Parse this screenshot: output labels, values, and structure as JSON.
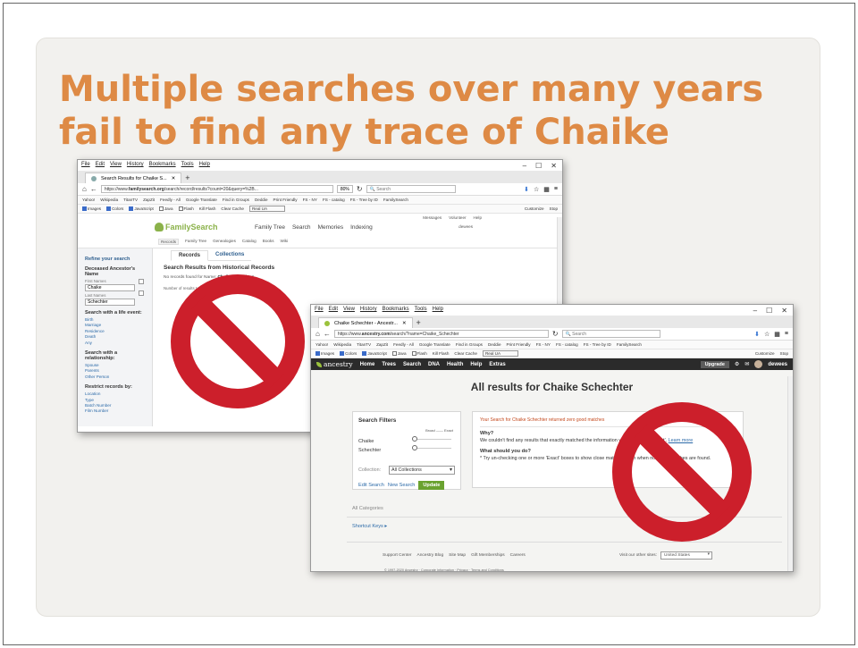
{
  "slide": {
    "title_line1": "Multiple searches over many years",
    "title_line2": "fail to find any trace of Chaike",
    "accent_color": "#de8a45",
    "prohibition_color": "#cc1f2b"
  },
  "familysearch": {
    "menu": [
      "File",
      "Edit",
      "View",
      "History",
      "Bookmarks",
      "Tools",
      "Help"
    ],
    "tab_title": "Search Results for Chaike S...",
    "url_host": "familysearch.org",
    "url_prefix": "https://www.",
    "url_path": "/search/record/results?count=20&query=%2B...",
    "zoom": "80%",
    "search_placeholder": "Search",
    "bookmarks": [
      "Yahoo!",
      "Wikipedia",
      "TitanTV",
      "ZapZit",
      "Feedly - All",
      "Google Translate",
      "Find in Groups",
      "Deddie",
      "Print Friendly",
      "FS - NY",
      "FS - catalog",
      "FS - Tree by ID",
      "FamilySearch"
    ],
    "devbar": [
      "Images",
      "Colors",
      "JavaScript",
      "Java",
      "Flash",
      "Kill Flash",
      "Clear Cache",
      "Real UA"
    ],
    "devbar_right": [
      "Customize",
      "Stop"
    ],
    "util_links": [
      "Messages",
      "Volunteer",
      "Help"
    ],
    "logo": "FamilySearch",
    "nav": [
      "Family Tree",
      "Search",
      "Memories",
      "Indexing"
    ],
    "user": "dewees",
    "subnav": [
      "Records",
      "Family Tree",
      "Genealogies",
      "Catalog",
      "Books",
      "Wiki"
    ],
    "sidebar": {
      "refine": "Refine your search",
      "deceased_heading": "Deceased Ancestor's Name",
      "first_names_label": "First Names",
      "first_name": "Chaike",
      "last_names_label": "Last Names",
      "last_name": "Schechter",
      "life_event_heading": "Search with a life event:",
      "life_events": [
        "Birth",
        "Marriage",
        "Residence",
        "Death",
        "Any"
      ],
      "relationship_heading": "Search with a relationship:",
      "relationships": [
        "Spouse",
        "Parents",
        "Other Person"
      ],
      "restrict_heading": "Restrict records by:",
      "restrictions": [
        "Location",
        "Type",
        "Batch Number",
        "Film Number"
      ]
    },
    "result_tabs": [
      "Records",
      "Collections"
    ],
    "results_heading": "Search Results from Historical Records",
    "no_records_prefix": "No records found for Name:",
    "no_records_name": "Chaike Schechter",
    "number_results": "Number of results to show"
  },
  "ancestry": {
    "menu": [
      "File",
      "Edit",
      "View",
      "History",
      "Bookmarks",
      "Tools",
      "Help"
    ],
    "tab_title": "Chaike Schechter - Ancestr...",
    "url_prefix": "https://www.",
    "url_host": "ancestry.com",
    "url_path": "/search/?name=Chaike_Schechter",
    "search_placeholder": "Search",
    "bookmarks": [
      "Yahoo!",
      "Wikipedia",
      "TitanTV",
      "ZapZit",
      "Feedly - All",
      "Google Translate",
      "Find in Groups",
      "Deddie",
      "Print Friendly",
      "FS - NY",
      "FS - catalog",
      "FS - Tree by ID",
      "FamilySearch"
    ],
    "devbar": [
      "Images",
      "Colors",
      "JavaScript",
      "Java",
      "Flash",
      "Kill Flash",
      "Clear Cache",
      "Real UA"
    ],
    "devbar_right": [
      "Customize",
      "Stop"
    ],
    "logo": "ancestry",
    "nav": [
      "Home",
      "Trees",
      "Search",
      "DNA",
      "Health",
      "Help",
      "Extras"
    ],
    "upgrade": "Upgrade",
    "user": "dewees",
    "heading": "All results for Chaike Schechter",
    "filters": {
      "title": "Search Filters",
      "scale_broad": "Broad",
      "scale_exact": "Exact",
      "first": "Chaike",
      "last": "Schechter",
      "collection_label": "Collection:",
      "collection_value": "All Collections",
      "edit": "Edit Search",
      "new": "New Search",
      "update": "Update"
    },
    "results": {
      "zero": "Your Search for Chaike Schechter returned zero good matches",
      "why": "Why?",
      "why_text": "We couldn't find any results that exactly matched the information you marked as 'Exact'.",
      "learn_more": "Learn more",
      "todo": "What should you do?",
      "todo_text": "* Try un-checking one or more 'Exact' boxes to show close matches even when no exact matches are found."
    },
    "all_categories": "All Categories",
    "shortcut_keys": "Shortcut Keys",
    "footer_links": [
      "Support Center",
      "Ancestry Blog",
      "Site Map",
      "Gift Memberships",
      "Careers"
    ],
    "other_sites_label": "Visit our other sites:",
    "other_sites_value": "United States",
    "copyright": "© 1997-2020 Ancestry · Corporate Information · Privacy · Terms and Conditions"
  }
}
